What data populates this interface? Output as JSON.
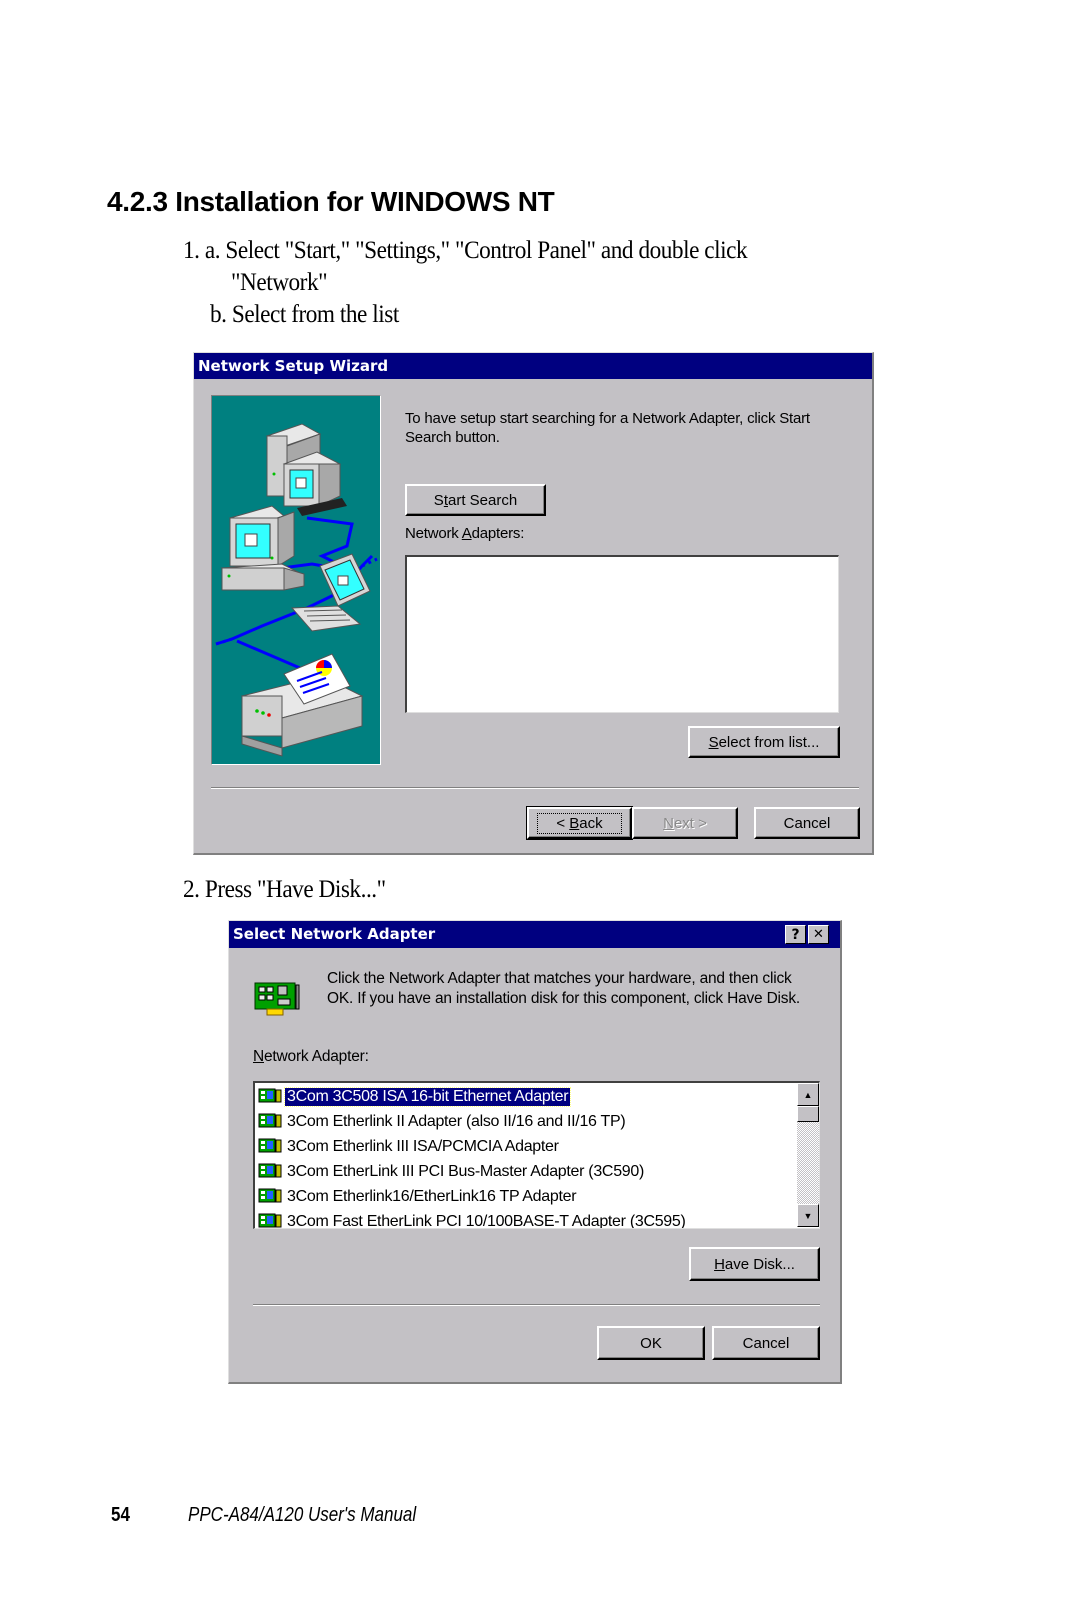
{
  "section": {
    "heading": "4.2.3 Installation for WINDOWS NT",
    "step1_line1": "1. a. Select \"Start,\" \"Settings,\" \"Control Panel\" and double click",
    "step1_line2": "\"Network\"",
    "step1_b": "b. Select from the list",
    "step2": "2. Press \"Have Disk...\""
  },
  "wizard": {
    "title": "Network Setup Wizard",
    "instruction": "To have setup start searching for a Network Adapter, click Start Search button.",
    "start_search_button": {
      "pre": "S",
      "key": "t",
      "post": "art Search"
    },
    "adapters_label": {
      "pre": "Network ",
      "key": "A",
      "post": "dapters:"
    },
    "adapters_list": [],
    "select_from_list_button": {
      "pre": "",
      "key": "S",
      "post": "elect from list..."
    },
    "back_button": {
      "pre": "< ",
      "key": "B",
      "post": "ack"
    },
    "next_button": {
      "pre": "",
      "key": "N",
      "post": "ext >"
    },
    "cancel_button": "Cancel",
    "illustration": "network-computers-illustration"
  },
  "select_adapter": {
    "title": "Select Network Adapter",
    "title_buttons": {
      "help": "?",
      "close": "✕"
    },
    "instruction": "Click the Network Adapter that matches your hardware, and then click OK.  If you have an installation disk for this component, click Have Disk.",
    "adapter_label": {
      "pre": "",
      "key": "N",
      "post": "etwork Adapter:"
    },
    "adapters": [
      {
        "name": "3Com 3C508 ISA 16-bit Ethernet Adapter",
        "selected": true
      },
      {
        "name": "3Com Etherlink II Adapter (also II/16 and II/16 TP)",
        "selected": false
      },
      {
        "name": "3Com Etherlink III ISA/PCMCIA Adapter",
        "selected": false
      },
      {
        "name": "3Com EtherLink III PCI Bus-Master Adapter (3C590)",
        "selected": false
      },
      {
        "name": "3Com Etherlink16/EtherLink16 TP Adapter",
        "selected": false
      },
      {
        "name": "3Com Fast EtherLink PCI 10/100BASE-T Adapter (3C595)",
        "selected": false
      }
    ],
    "scroll_up": "▲",
    "scroll_down": "▼",
    "have_disk_button": {
      "pre": "",
      "key": "H",
      "post": "ave Disk..."
    },
    "ok_button": "OK",
    "cancel_button": "Cancel"
  },
  "footer": {
    "page_number": "54",
    "manual_title": "PPC-A84/A120 User's Manual"
  },
  "colors": {
    "titlebar": "#000080",
    "dialog_face": "#c3c1c5",
    "illustration_bg": "#008080",
    "network_cable": "#0000ff"
  }
}
